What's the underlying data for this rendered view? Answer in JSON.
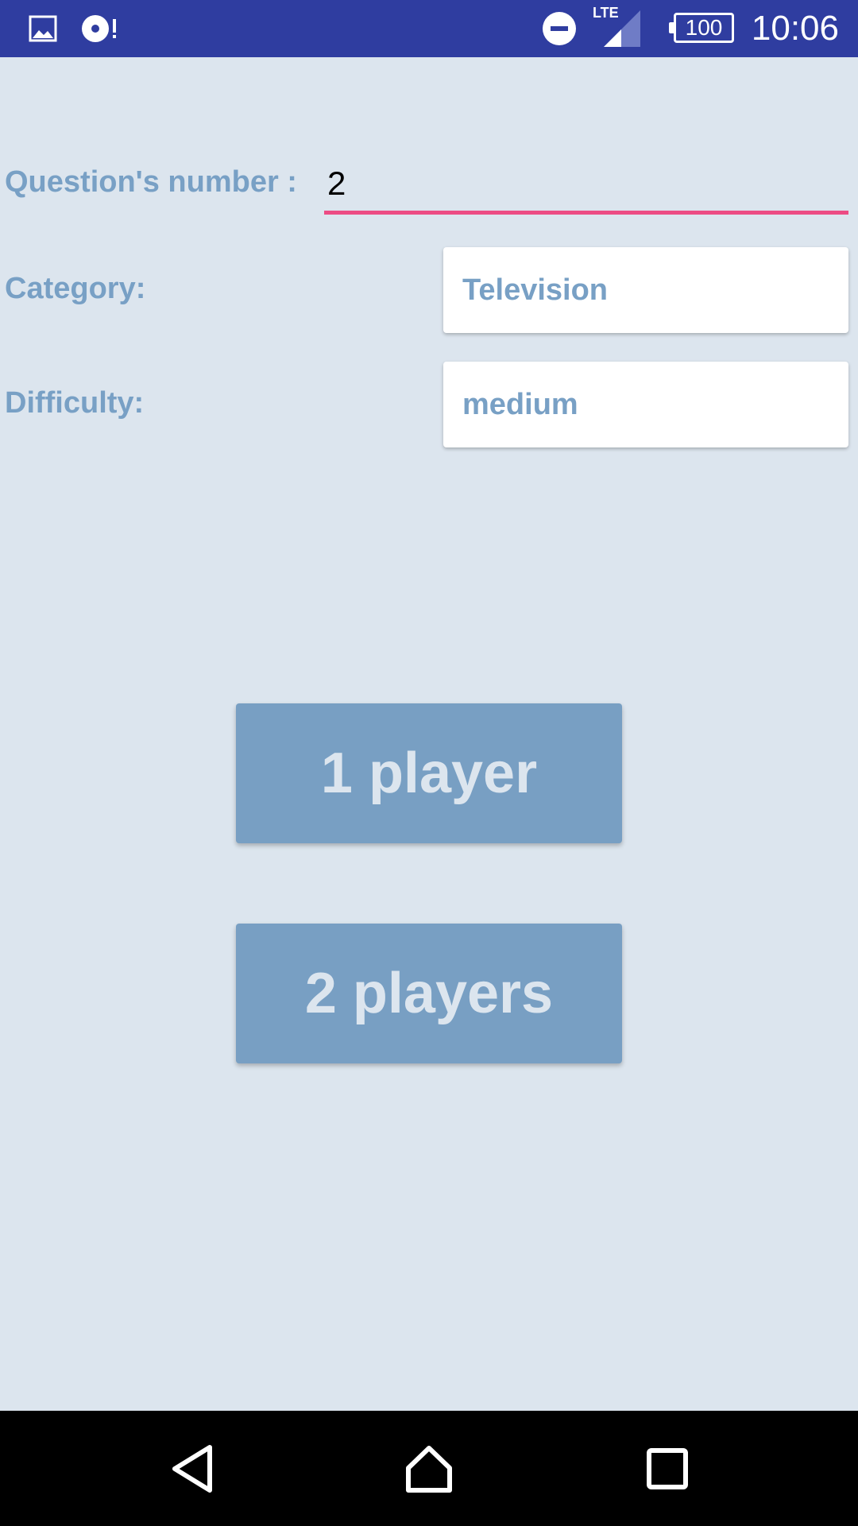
{
  "status_bar": {
    "time": "10:06",
    "battery": "100",
    "network": "LTE",
    "icons": [
      "image-icon",
      "music-icon",
      "do-not-disturb-icon",
      "signal-icon",
      "battery-icon"
    ]
  },
  "form": {
    "question_label": "Question's number :",
    "question_value": "2",
    "category_label": "Category:",
    "category_value": "Television",
    "difficulty_label": "Difficulty:",
    "difficulty_value": "medium"
  },
  "buttons": {
    "one_player": "1 player",
    "two_players": "2 players"
  },
  "nav_bar": {
    "icons": [
      "back-icon",
      "home-icon",
      "recents-icon"
    ]
  },
  "colors": {
    "status_bar": "#2f3da0",
    "background": "#dce5ee",
    "accent_text": "#78a0c5",
    "input_underline": "#ec4c84",
    "button_bg": "#789fc3"
  }
}
